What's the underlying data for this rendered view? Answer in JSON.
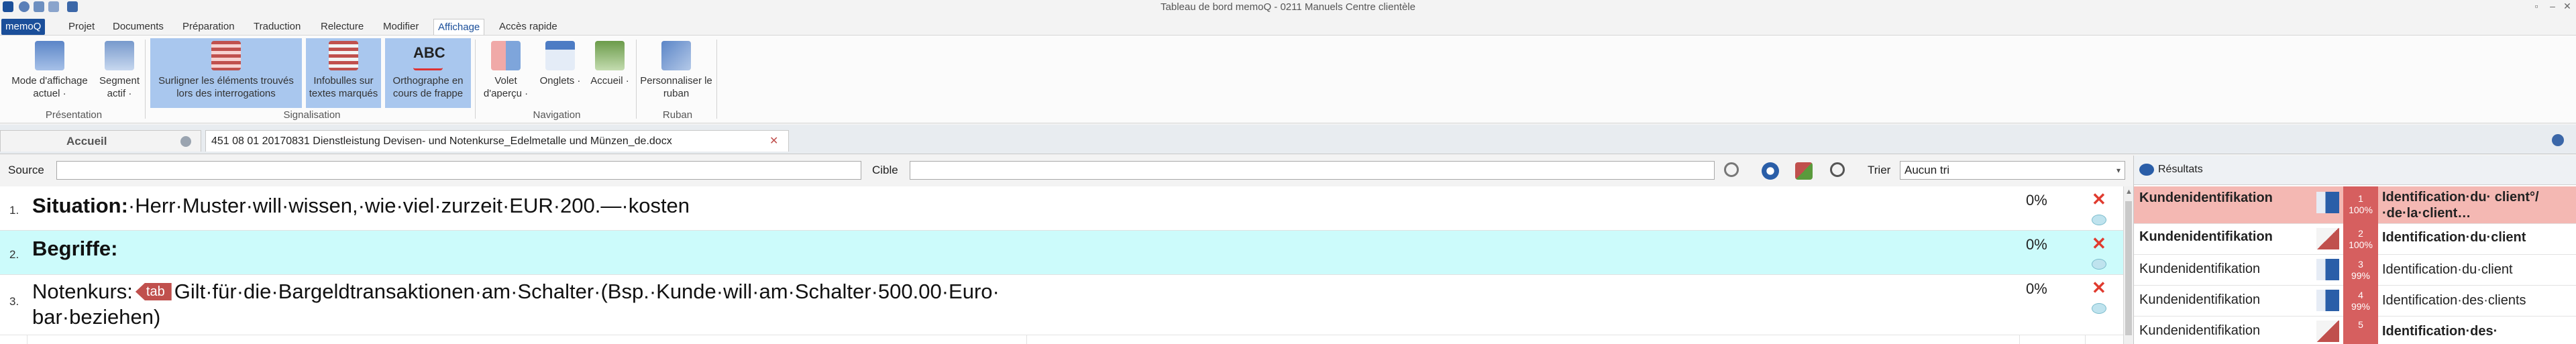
{
  "window": {
    "title": "Tableau de bord memoQ - 0211 Manuels Centre clientèle"
  },
  "menu": {
    "app_label": "memoQ",
    "tabs": [
      "Projet",
      "Documents",
      "Préparation",
      "Traduction",
      "Relecture",
      "Modifier",
      "Affichage",
      "Accès rapide"
    ],
    "active_tab": "Affichage"
  },
  "ribbon": {
    "buttons": [
      {
        "label": "Mode d'affichage actuel ·"
      },
      {
        "label": "Segment actif ·"
      },
      {
        "label": "Surligner les éléments trouvés lors des interrogations"
      },
      {
        "label": "Infobulles sur textes marqués"
      },
      {
        "label": "Orthographe en cours de frappe",
        "icon_text": "ABC"
      },
      {
        "label": "Volet d'aperçu ·"
      },
      {
        "label": "Onglets ·"
      },
      {
        "label": "Accueil ·"
      },
      {
        "label": "Personnaliser le ruban"
      }
    ],
    "groups": [
      "Présentation",
      "Signalisation",
      "Navigation",
      "Ruban"
    ]
  },
  "doc_tabs": {
    "home": "Accueil",
    "document": "451 08 01 20170831 Dienstleistung Devisen- und Notenkurse_Edelmetalle und Münzen_de.docx"
  },
  "filter": {
    "source_label": "Source",
    "target_label": "Cible",
    "sort_label": "Trier",
    "sort_value": "Aucun tri"
  },
  "segments": [
    {
      "num": "1.",
      "label": "Situation:",
      "text": "·Herr·Muster·will·wissen,·wie·viel·zurzeit·EUR·200.—·kosten",
      "percent": "0%"
    },
    {
      "num": "2.",
      "label": "Begriffe:",
      "text": "",
      "percent": "0%"
    },
    {
      "num": "3.",
      "label": "Notenkurs:",
      "tag": "tab",
      "text": "Gilt·für·die·Bargeldtransaktionen·am·Schalter·(Bsp.·Kunde·will·am·Schalter·500.00·Euro·",
      "text2": "bar·beziehen)",
      "percent": "0%"
    }
  ],
  "results": {
    "title": "Résultats",
    "rows": [
      {
        "source": "Kundenidentifikation",
        "num": "1",
        "pct": "100%",
        "target": "Identification·du· client°/·de·la·client…",
        "bold": true
      },
      {
        "source": "Kundenidentifikation",
        "num": "2",
        "pct": "100%",
        "target": "Identification·du·client",
        "bold": true
      },
      {
        "source": "Kundenidentifikation",
        "num": "3",
        "pct": "99%",
        "target": "Identification·du·client",
        "bold": false
      },
      {
        "source": "Kundenidentifikation",
        "num": "4",
        "pct": "99%",
        "target": "Identification·des·clients",
        "bold": false
      },
      {
        "source": "Kundenidentifikation",
        "num": "5",
        "pct": "",
        "target": "Identification·des·",
        "bold": true
      }
    ]
  },
  "colors": {
    "accent": "#1b4f9a",
    "highlight": "#a9c7ee",
    "tag": "#c0504d",
    "row_active": "#ccfbfb",
    "match": "#d65f5f"
  }
}
